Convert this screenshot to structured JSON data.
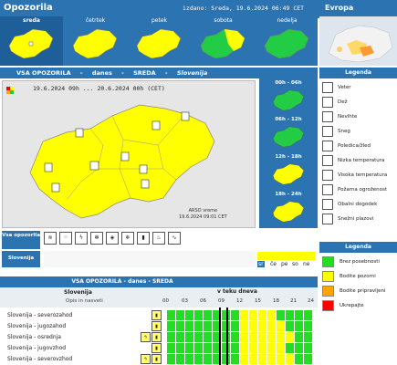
{
  "header": {
    "title": "Opozorila",
    "issued": "izdano: Sreda, 19.6.2024 06:49 CET",
    "europe_label": "Evropa"
  },
  "days": [
    {
      "label": "sreda",
      "selected": true
    },
    {
      "label": "četrtek",
      "selected": false
    },
    {
      "label": "petek",
      "selected": false
    },
    {
      "label": "sobota",
      "selected": false
    },
    {
      "label": "nedelja",
      "selected": false
    }
  ],
  "main": {
    "title_parts": [
      "VSA OPOZORILA",
      "-",
      "danes",
      "-",
      "SREDA",
      "-",
      "Slovenija"
    ],
    "range": "19.6.2024 09h ... 20.6.2024 00h   (CET)",
    "arso_line1": "ARSO vreme",
    "arso_line2": "19.6.2024  09:01 CET"
  },
  "time_slots": [
    {
      "label": "00h - 06h",
      "color": "#22cc44"
    },
    {
      "label": "06h - 12h",
      "color": "#22cc44"
    },
    {
      "label": "12h - 18h",
      "color": "#ffff00"
    },
    {
      "label": "18h - 24h",
      "color": "#ffff00"
    }
  ],
  "rows": {
    "vsa_label": "Vsa opozorila",
    "slovenija_label": "Slovenija",
    "day_mini": [
      "sr",
      "če",
      "pe",
      "so",
      "ne"
    ]
  },
  "legend": {
    "title": "Legenda",
    "items": [
      {
        "label": "Veter",
        "icon": "wind-icon"
      },
      {
        "label": "Dež",
        "icon": "rain-icon"
      },
      {
        "label": "Nevihte",
        "icon": "thunderstorm-icon"
      },
      {
        "label": "Sneg",
        "icon": "snow-icon"
      },
      {
        "label": "Poledica/žled",
        "icon": "ice-icon"
      },
      {
        "label": "Nizka temperatura",
        "icon": "low-temperature-icon"
      },
      {
        "label": "Visoka temperatura",
        "icon": "high-temperature-icon"
      },
      {
        "label": "Požarna ogroženost",
        "icon": "fire-risk-icon"
      },
      {
        "label": "Obalni dogodek",
        "icon": "coastal-event-icon"
      },
      {
        "label": "Snežni plazovi",
        "icon": "avalanche-icon"
      }
    ]
  },
  "levels": {
    "title": "Legenda",
    "items": [
      {
        "label": "Brez posebnosti",
        "color": "#22dd22"
      },
      {
        "label": "Bodite pozorni",
        "color": "#ffff00"
      },
      {
        "label": "Bodite pripravljeni",
        "color": "#ffa500"
      },
      {
        "label": "Ukrepajte",
        "color": "#ff0000"
      }
    ]
  },
  "table": {
    "title": "VSA OPOZORILA - danes - SREDA",
    "region_header": "Slovenija",
    "opis_header": "Opis in nasveti",
    "now_header": "v teku dneva",
    "hours": [
      "00",
      "03",
      "06",
      "09",
      "12",
      "15",
      "18",
      "21",
      "24"
    ],
    "rows": [
      {
        "name": "Slovenija - severozahod",
        "icons": [
          "thermometer"
        ]
      },
      {
        "name": "Slovenija - jugozahod",
        "icons": [
          "thermometer"
        ]
      },
      {
        "name": "Slovenija - osrednja",
        "icons": [
          "storm",
          "thermometer"
        ]
      },
      {
        "name": "Slovenija - jugovzhod",
        "icons": [
          "thermometer"
        ]
      },
      {
        "name": "Slovenija - severovzhod",
        "icons": [
          "storm",
          "thermometer"
        ]
      }
    ]
  }
}
